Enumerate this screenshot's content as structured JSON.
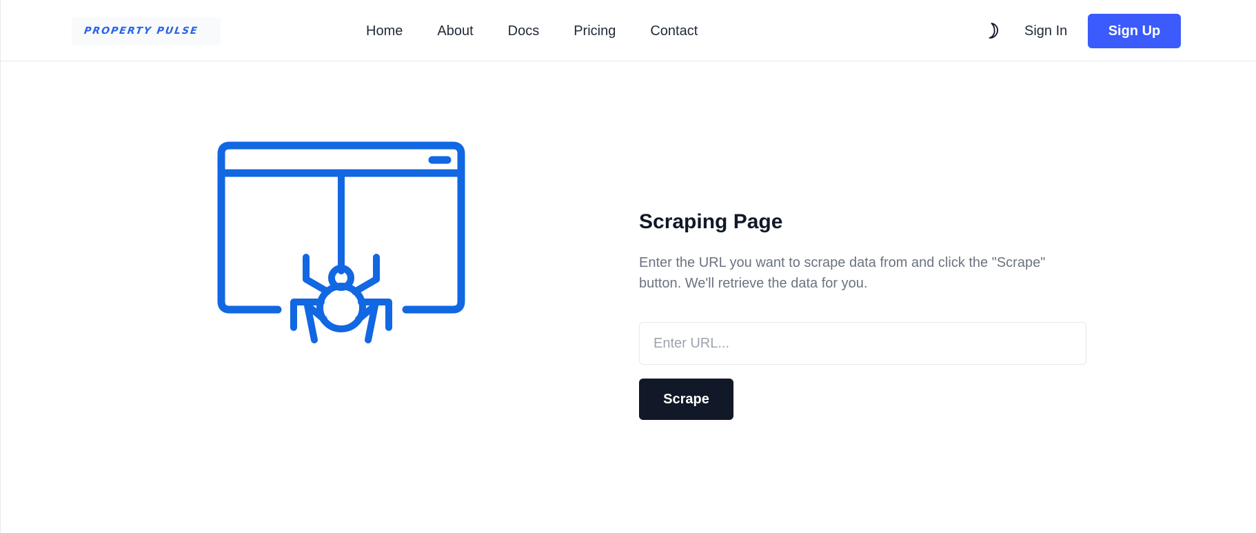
{
  "header": {
    "logo_text": "PROPERTY PULSE",
    "nav": [
      {
        "label": "Home"
      },
      {
        "label": "About"
      },
      {
        "label": "Docs"
      },
      {
        "label": "Pricing"
      },
      {
        "label": "Contact"
      }
    ],
    "theme_icon": "moon-icon",
    "sign_in_label": "Sign In",
    "sign_up_label": "Sign Up"
  },
  "main": {
    "illustration_icon": "spider-web-browser-icon",
    "title": "Scraping Page",
    "description": "Enter the URL you want to scrape data from and click the \"Scrape\" button. We'll retrieve the data for you.",
    "url_input": {
      "value": "",
      "placeholder": "Enter URL..."
    },
    "scrape_label": "Scrape"
  },
  "colors": {
    "accent": "#3b5bfc",
    "illustration": "#1267e2",
    "dark_button": "#111827",
    "logo": "#2563eb"
  }
}
